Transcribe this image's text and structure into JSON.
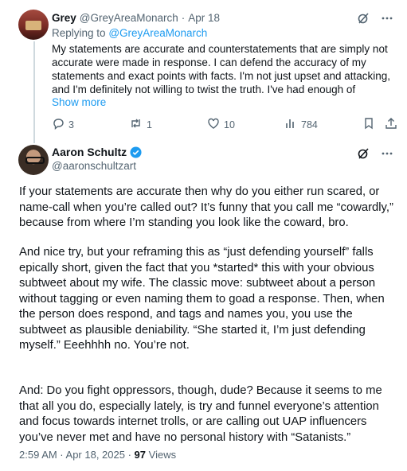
{
  "reply": {
    "author_name": "Grey",
    "author_handle": "@GreyAreaMonarch",
    "separator": "·",
    "date": "Apr 18",
    "replying_prefix": "Replying to",
    "replying_to": "@GreyAreaMonarch",
    "text": "My statements are accurate and counterstatements that are simply not accurate were made in response. I can defend the accuracy of my statements and exact points with facts. I'm not just upset and attacking, and I'm definitely not willing to twist the truth. I've had enough of",
    "show_more": "Show more",
    "stats": {
      "replies": "3",
      "reposts": "1",
      "likes": "10",
      "views": "784"
    }
  },
  "main": {
    "author_name": "Aaron Schultz",
    "author_handle": "@aaronschultzart",
    "paragraph_1": "If your statements are accurate then why do you either run scared, or name-call when you’re called out? It’s funny that you call me “cowardly,” because from where I’m standing you look like the coward, bro.",
    "paragraph_2": "And nice try, but your reframing this as “just defending yourself” falls epically short, given the fact that you *started* this with your obvious subtweet about my wife. The classic move: subtweet about a person without tagging or even naming them to goad a response. Then, when the person does respond, and tags and names you, you use the subtweet as plausible deniability. “She started it, I’m just defending myself.” Eeehhhh no. You’re not.",
    "paragraph_3": "And: Do you fight oppressors, though, dude? Because it seems to me that all you do, especially lately, is try and funnel everyone’s attention and focus towards internet trolls, or are calling out UAP influencers you’ve never met and have no personal history with “Satanists.”",
    "timestamp": "2:59 AM · Apr 18, 2025 ·",
    "views_count": "97",
    "views_label": "Views"
  },
  "colors": {
    "accent": "#1d9bf0",
    "muted": "#536471",
    "text": "#0f1419",
    "thread_line": "#cfd9de"
  },
  "icons": [
    "grok-icon",
    "more-icon",
    "reply-icon",
    "repost-icon",
    "like-icon",
    "views-icon",
    "bookmark-icon",
    "share-icon",
    "verified-icon"
  ]
}
